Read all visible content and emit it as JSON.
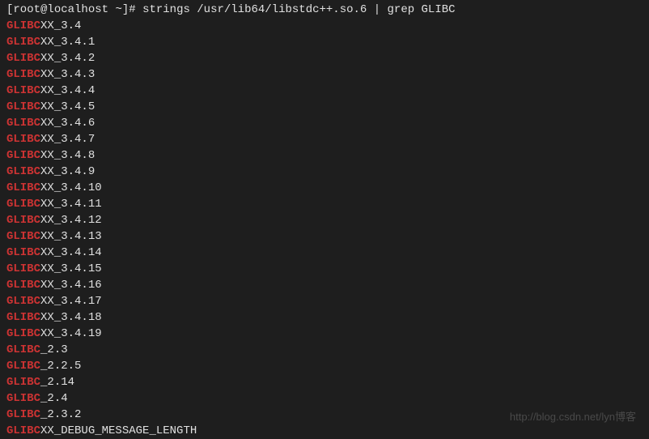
{
  "prompt": {
    "open_bracket": "[",
    "user_host": "root@localhost",
    "separator": " ",
    "path": "~",
    "close_bracket": "]",
    "symbol": "#",
    "command": "strings /usr/lib64/libstdc++.so.6 | grep GLIBC"
  },
  "output_lines": [
    {
      "match": "GLIBC",
      "rest": "XX_3.4"
    },
    {
      "match": "GLIBC",
      "rest": "XX_3.4.1"
    },
    {
      "match": "GLIBC",
      "rest": "XX_3.4.2"
    },
    {
      "match": "GLIBC",
      "rest": "XX_3.4.3"
    },
    {
      "match": "GLIBC",
      "rest": "XX_3.4.4"
    },
    {
      "match": "GLIBC",
      "rest": "XX_3.4.5"
    },
    {
      "match": "GLIBC",
      "rest": "XX_3.4.6"
    },
    {
      "match": "GLIBC",
      "rest": "XX_3.4.7"
    },
    {
      "match": "GLIBC",
      "rest": "XX_3.4.8"
    },
    {
      "match": "GLIBC",
      "rest": "XX_3.4.9"
    },
    {
      "match": "GLIBC",
      "rest": "XX_3.4.10"
    },
    {
      "match": "GLIBC",
      "rest": "XX_3.4.11"
    },
    {
      "match": "GLIBC",
      "rest": "XX_3.4.12"
    },
    {
      "match": "GLIBC",
      "rest": "XX_3.4.13"
    },
    {
      "match": "GLIBC",
      "rest": "XX_3.4.14"
    },
    {
      "match": "GLIBC",
      "rest": "XX_3.4.15"
    },
    {
      "match": "GLIBC",
      "rest": "XX_3.4.16"
    },
    {
      "match": "GLIBC",
      "rest": "XX_3.4.17"
    },
    {
      "match": "GLIBC",
      "rest": "XX_3.4.18"
    },
    {
      "match": "GLIBC",
      "rest": "XX_3.4.19"
    },
    {
      "match": "GLIBC",
      "rest": "_2.3"
    },
    {
      "match": "GLIBC",
      "rest": "_2.2.5"
    },
    {
      "match": "GLIBC",
      "rest": "_2.14"
    },
    {
      "match": "GLIBC",
      "rest": "_2.4"
    },
    {
      "match": "GLIBC",
      "rest": "_2.3.2"
    },
    {
      "match": "GLIBC",
      "rest": "XX_DEBUG_MESSAGE_LENGTH"
    }
  ],
  "watermark": "http://blog.csdn.net/lyn博客"
}
